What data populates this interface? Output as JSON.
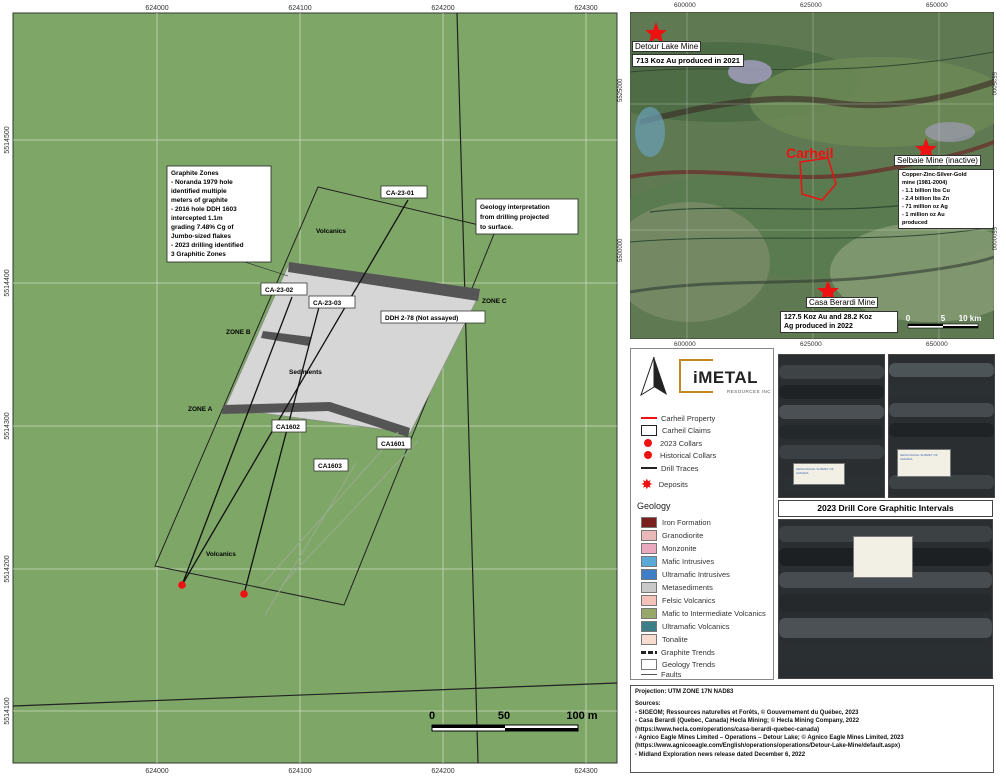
{
  "main_map": {
    "top_ticks": [
      "624000",
      "624100",
      "624200",
      "624300"
    ],
    "bottom_ticks": [
      "624000",
      "624100",
      "624200",
      "624300"
    ],
    "left_ticks": [
      "5514500",
      "5514400",
      "5514300",
      "5514200",
      "5514100"
    ],
    "labels": {
      "graphite_title": "Graphite Zones",
      "graphite_lines": [
        "- Noranda 1979 hole",
        "identified multiple",
        "meters of graphite",
        "- 2016 hole DDH 1603",
        "intercepted 1.1m",
        "grading 7.48% Cg of",
        "Jumbo-sized flakes",
        "- 2023 drilling identified",
        "3 Graphitic Zones"
      ],
      "interp_lines": [
        "Geology interpretation",
        "from drilling projected",
        "to surface."
      ],
      "ca2301": "CA-23-01",
      "ca2302": "CA-23-02",
      "ca2303": "CA-23-03",
      "ddh278": "DDH 2-78 (Not assayed)",
      "ca1602": "CA1602",
      "ca1601": "CA1601",
      "ca1603": "CA1603",
      "zone_a": "ZONE A",
      "zone_b": "ZONE B",
      "zone_c": "ZONE C",
      "volcanics_top": "Volcanics",
      "volcanics_bottom": "Volcanics",
      "sediments": "Sediments"
    },
    "scale": [
      "0",
      "50",
      "100 m"
    ]
  },
  "regional_map": {
    "top_ticks": [
      "600000",
      "625000",
      "650000"
    ],
    "bottom_ticks": [
      "600000",
      "625000",
      "650000"
    ],
    "left_ticks": [
      "5525000",
      "5500000"
    ],
    "right_ticks": [
      "5525000",
      "5500000"
    ],
    "detour_name": "Detour Lake Mine",
    "detour_production": "713 Koz Au produced in 2021",
    "carheil": "Carheil",
    "selbaie_name": "Selbaie Mine (inactive)",
    "selbaie_lines": [
      "Copper-Zinc-Silver-Gold",
      "mine (1981-2004)",
      "- 1.1 billion lbs Cu",
      "- 2.4 billion lbs Zn",
      "- 71 million oz Ag",
      "- 1 million oz Au",
      "produced"
    ],
    "casa_name": "Casa Berardi Mine",
    "casa_lines": [
      "127.5 Koz Au and 28.2 Koz",
      "Ag produced in 2022"
    ],
    "scale": [
      "0",
      "5",
      "10 km"
    ]
  },
  "logo": {
    "main": "iMETAL",
    "sub": "RESOURCES INC"
  },
  "legend": {
    "items": [
      {
        "label": "Carheil Property",
        "kind": "redline"
      },
      {
        "label": "Carheil Claims",
        "kind": "box"
      },
      {
        "label": "2023 Collars",
        "kind": "reddot"
      },
      {
        "label": "Historical Collars",
        "kind": "reddot"
      },
      {
        "label": "Drill Traces",
        "kind": "line"
      },
      {
        "label": "Deposits",
        "kind": "star"
      }
    ],
    "geology_title": "Geology",
    "geology": [
      {
        "label": "Iron Formation",
        "color": "#7a1e1e"
      },
      {
        "label": "Granodiorite",
        "color": "#e9b8b8"
      },
      {
        "label": "Monzonite",
        "color": "#e9a9bf"
      },
      {
        "label": "Mafic Intrusives",
        "color": "#5aa9d6"
      },
      {
        "label": "Ultramafic Intrusives",
        "color": "#3f7fc7"
      },
      {
        "label": "Metasediments",
        "color": "#c9c9c9"
      },
      {
        "label": "Felsic Volcanics",
        "color": "#f3c2b8"
      },
      {
        "label": "Mafic to Intermediate Volcanics",
        "color": "#97a86a"
      },
      {
        "label": "Ultramafic Volcanics",
        "color": "#3d7f86"
      },
      {
        "label": "Tonalite",
        "color": "#f7ddd0"
      }
    ],
    "trends": [
      {
        "label": "Graphite Trends",
        "kind": "dash"
      },
      {
        "label": "Geology Trends",
        "kind": "box"
      },
      {
        "label": "Faults",
        "kind": "thin"
      }
    ]
  },
  "core_title": "2023 Drill Core Graphitic Intervals",
  "photo_tags": {
    "left": "GEOLOGICAL SURVEY OF CANADA",
    "right": "GEOLOGICAL SURVEY OF CANADA"
  },
  "notes": {
    "projection": "Projection: UTM ZONE 17N NAD83",
    "sources_title": "Sources:",
    "sources": [
      "- SIGEOM; Ressources naturelles et Forêts, © Gouvernement du Québec, 2023",
      "- Casa Berardi (Quebec, Canada) Hecla Mining; © Hecla Mining Company, 2022",
      "  (https://www.hecla.com/operations/casa-berardi-quebec-canada)",
      "- Agnico Eagle Mines Limited – Operations – Detour Lake; © Agnico Eagle Mines Limited, 2023",
      "  (https://www.agnicoeagle.com/English/operations/operations/Detour-Lake-Mine/default.aspx)",
      "- Midland Exploration news release dated December 6, 2022"
    ]
  }
}
